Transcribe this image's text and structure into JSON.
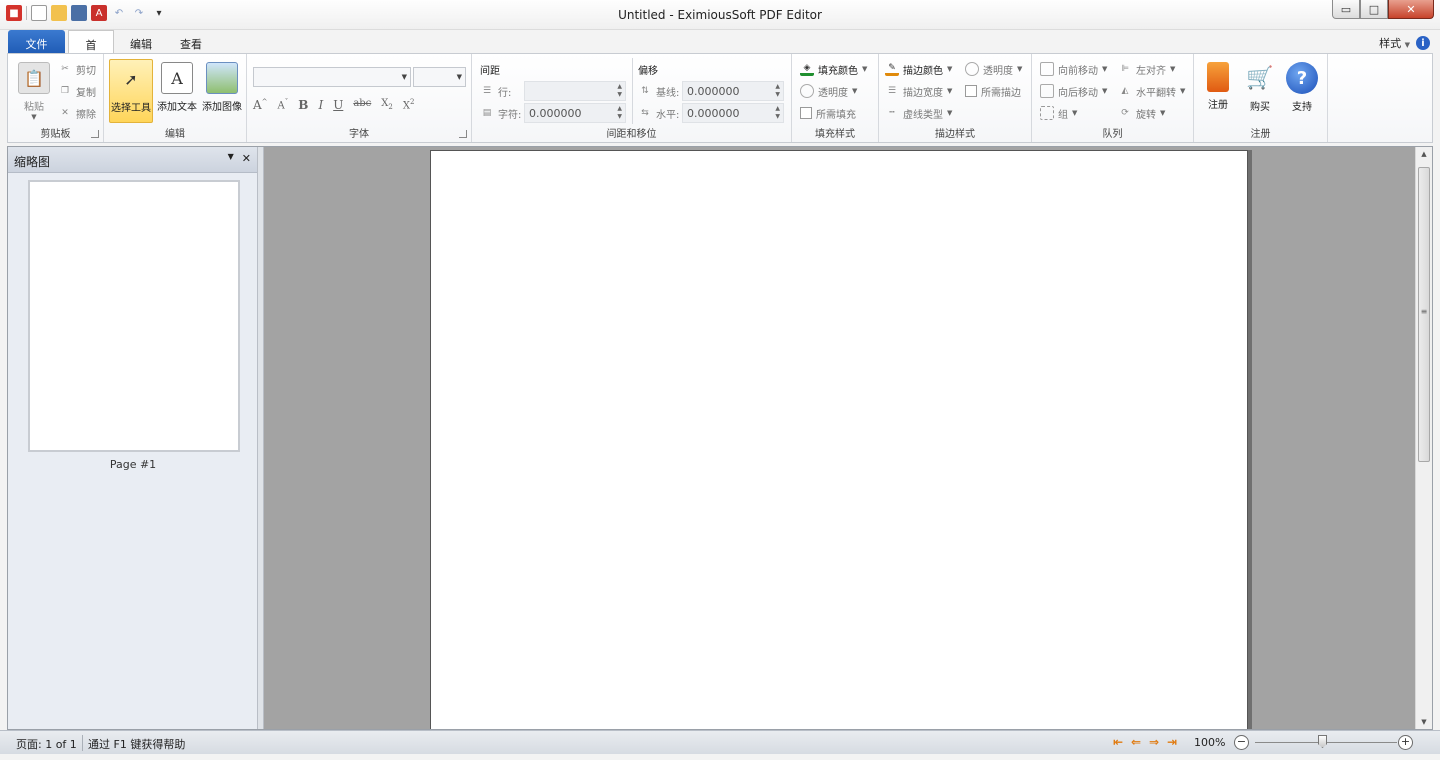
{
  "window": {
    "title": "Untitled - EximiousSoft PDF Editor",
    "controls": {
      "minimize": "▭",
      "maximize": "□",
      "close": "✕"
    }
  },
  "quick_access": {
    "icons": [
      "app-logo-icon",
      "new-file-icon",
      "open-folder-icon",
      "save-icon",
      "pdf-icon",
      "undo-icon",
      "redo-icon",
      "customize-dropdown-icon"
    ]
  },
  "tabs": {
    "file": "文件",
    "home": "首页",
    "edit": "编辑",
    "view": "查看",
    "style_menu": "样式"
  },
  "ribbon": {
    "clipboard": {
      "label": "剪贴板",
      "paste": "粘贴",
      "cut": "剪切",
      "copy": "复制",
      "delete": "擦除"
    },
    "edit": {
      "label": "编辑",
      "select_tool": "选择工具",
      "add_text": "添加文本",
      "add_image": "添加图像"
    },
    "font": {
      "label": "字体",
      "font_name": "",
      "font_size": ""
    },
    "spacing": {
      "label": "间距和移位",
      "spacing_title": "间距",
      "line": "行:",
      "char": "字符:",
      "char_value": "0.000000",
      "offset_title": "偏移",
      "baseline": "基线:",
      "baseline_value": "0.000000",
      "horizontal": "水平:",
      "horizontal_value": "0.000000"
    },
    "fill": {
      "label": "填充样式",
      "fill_color": "填充颜色",
      "opacity": "透明度",
      "need_fill": "所需填充"
    },
    "stroke": {
      "label": "描边样式",
      "stroke_color": "描边颜色",
      "opacity": "透明度",
      "stroke_width": "描边宽度",
      "need_stroke": "所需描边",
      "dash_type": "虚线类型"
    },
    "arrange": {
      "label": "队列",
      "bring_forward": "向前移动",
      "send_backward": "向后移动",
      "group": "组",
      "align_left": "左对齐",
      "flip_horizontal": "水平翻转",
      "rotate": "旋转"
    },
    "register": {
      "label": "注册",
      "register": "注册",
      "buy": "购买",
      "support": "支持"
    }
  },
  "thumbnails": {
    "title": "缩略图",
    "page_label": "Page #1"
  },
  "status": {
    "page": "页面: 1 of 1",
    "help": "通过 F1 键获得帮助",
    "zoom": "100%"
  },
  "colors": {
    "file_tab": "#1f5bb5",
    "selected_button": "#ffd55a",
    "canvas": "#a3a3a3",
    "nav_arrows": "#e07b12"
  }
}
